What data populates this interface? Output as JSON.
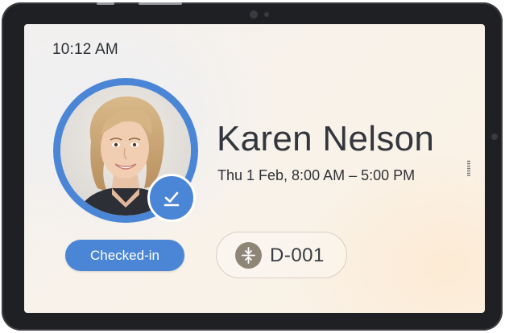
{
  "status_bar": {
    "time": "10:12 AM"
  },
  "visitor": {
    "name": "Karen Nelson",
    "schedule": "Thu 1 Feb, 8:00 AM – 5:00 PM",
    "status_label": "Checked-in",
    "desk_code": "D-001"
  },
  "icons": {
    "check_badge": "check-in-icon",
    "desk": "collapse-vertical-icon"
  },
  "colors": {
    "accent": "#4b86d6",
    "desk_icon_bg": "#8e8577",
    "text_primary": "#33363d",
    "device_frame": "#1f2023"
  }
}
